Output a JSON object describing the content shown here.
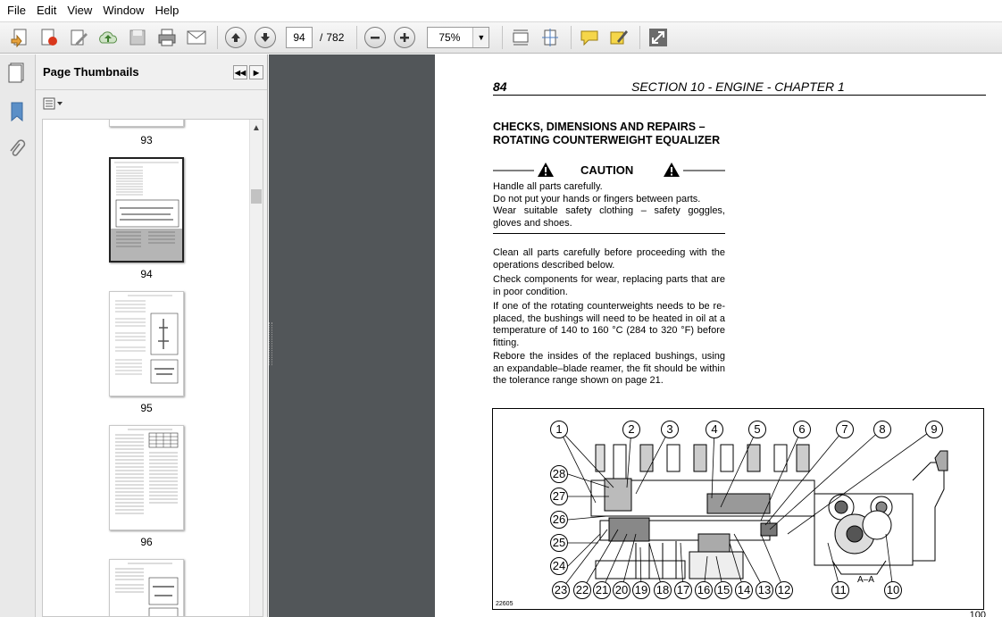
{
  "menu": [
    "File",
    "Edit",
    "View",
    "Window",
    "Help"
  ],
  "toolbar": {
    "page_current": "94",
    "page_separator": "/",
    "page_total": "782",
    "zoom": "75%"
  },
  "panel": {
    "title": "Page Thumbnails"
  },
  "thumbnails": [
    {
      "label": "93"
    },
    {
      "label": "94"
    },
    {
      "label": "95"
    },
    {
      "label": "96"
    }
  ],
  "doc": {
    "page_number": "84",
    "section": "SECTION 10 - ENGINE - CHAPTER 1",
    "title_line1": "CHECKS, DIMENSIONS AND REPAIRS –",
    "title_line2": "ROTATING COUNTERWEIGHT EQUALIZER",
    "caution": "CAUTION",
    "caution_lines": [
      "Handle all parts carefully.",
      "Do not put your hands or fingers between parts.",
      "Wear suitable safety clothing – safety goggles, gloves and shoes."
    ],
    "paragraphs": [
      "Clean all parts carefully before proceeding with the operations described below.",
      "Check components for wear, replacing parts that are in poor condition.",
      "If one of the rotating counterweights needs to be re-placed, the bushings will need to be heated in oil at a temperature of 140 to 160 °C (284 to 320 °F) before fitting.",
      "Rebore the insides of the replaced bushings, using an expandable–blade reamer, the fit should be within the tolerance range shown on page 21."
    ],
    "figure": {
      "code": "22605",
      "section_label": "A–A",
      "callouts_top": [
        "1",
        "2",
        "3",
        "4",
        "5",
        "6",
        "7",
        "8",
        "9"
      ],
      "callouts_left": [
        "28",
        "27",
        "26",
        "25",
        "24"
      ],
      "callouts_bottom": [
        "23",
        "22",
        "21",
        "20",
        "19",
        "18",
        "17",
        "16",
        "15",
        "14",
        "13",
        "12",
        "11",
        "10"
      ]
    },
    "next_page_fragment": "100"
  }
}
